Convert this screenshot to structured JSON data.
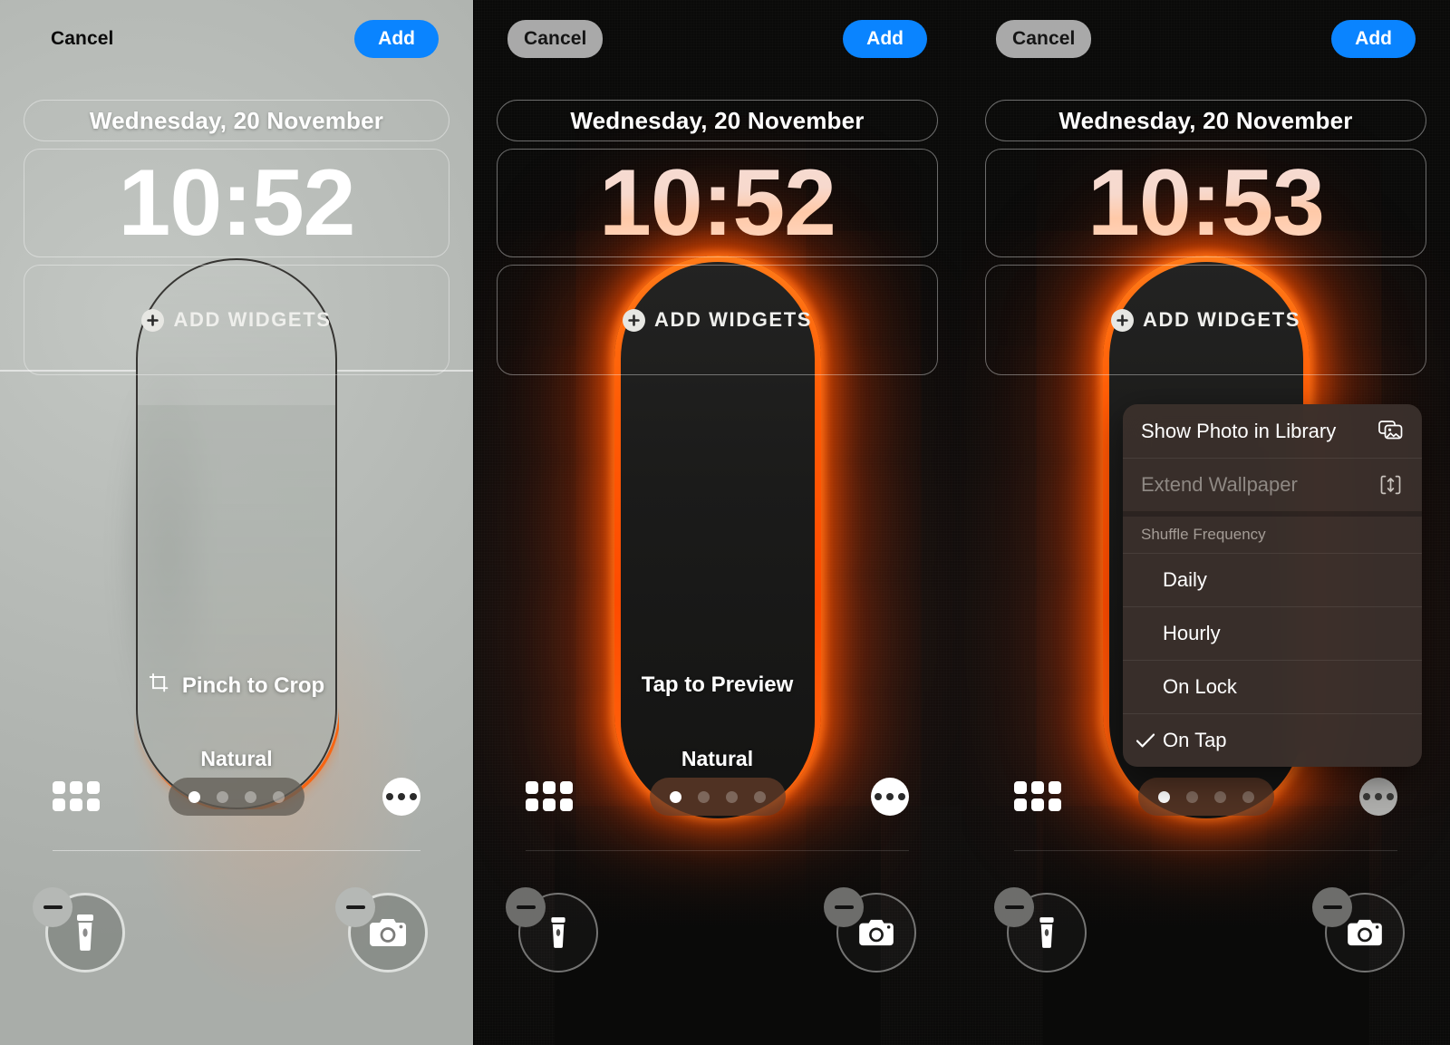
{
  "panels": [
    {
      "theme": "light",
      "topbar": {
        "cancel": "Cancel",
        "add": "Add"
      },
      "date": "Wednesday, 20 November",
      "time": "10:52",
      "widgets_label": "ADD WIDGETS",
      "hint": "Pinch to Crop",
      "hint_icon": "crop-icon",
      "style_label": "Natural",
      "page_dots": {
        "count": 4,
        "active_index": 0
      },
      "grid_icon": "grid-icon",
      "more_icon": "ellipsis-icon",
      "shortcuts": {
        "left": "flashlight-icon",
        "right": "camera-icon",
        "badge": "minus-icon"
      }
    },
    {
      "theme": "dark",
      "topbar": {
        "cancel": "Cancel",
        "add": "Add"
      },
      "date": "Wednesday, 20 November",
      "time": "10:52",
      "widgets_label": "ADD WIDGETS",
      "hint": "Tap to Preview",
      "hint_icon": "none",
      "style_label": "Natural",
      "page_dots": {
        "count": 4,
        "active_index": 0
      },
      "grid_icon": "grid-icon",
      "more_icon": "ellipsis-icon",
      "shortcuts": {
        "left": "flashlight-icon",
        "right": "camera-icon",
        "badge": "minus-icon"
      }
    },
    {
      "theme": "dark",
      "topbar": {
        "cancel": "Cancel",
        "add": "Add"
      },
      "date": "Wednesday, 20 November",
      "time": "10:53",
      "widgets_label": "ADD WIDGETS",
      "hint": "",
      "hint_icon": "none",
      "style_label": "",
      "page_dots": {
        "count": 4,
        "active_index": 0
      },
      "grid_icon": "grid-icon",
      "more_icon": "ellipsis-icon",
      "shortcuts": {
        "left": "flashlight-icon",
        "right": "camera-icon",
        "badge": "minus-icon"
      }
    }
  ],
  "context_menu": {
    "items": [
      {
        "label": "Show Photo in Library",
        "icon": "photo-library-icon",
        "disabled": false
      },
      {
        "label": "Extend Wallpaper",
        "icon": "extend-arrows-icon",
        "disabled": true
      }
    ],
    "section_header": "Shuffle Frequency",
    "choices": [
      {
        "label": "Daily",
        "selected": false
      },
      {
        "label": "Hourly",
        "selected": false
      },
      {
        "label": "On Lock",
        "selected": false
      },
      {
        "label": "On Tap",
        "selected": true
      }
    ]
  },
  "colors": {
    "accent_blue": "#0a84ff",
    "glow_orange": "#ff5a05",
    "light_bg": "#b9bdb9",
    "dark_bg": "#0a0a09",
    "menu_bg": "#3a2f2b"
  }
}
